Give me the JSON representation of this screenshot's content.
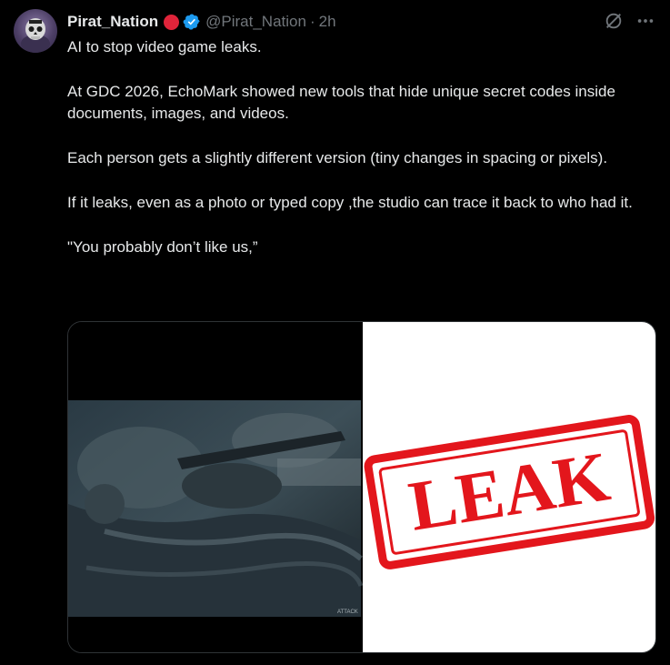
{
  "author": {
    "display_name": "Pirat_Nation",
    "handle": "@Pirat_Nation",
    "separator": "·",
    "timestamp": "2h"
  },
  "icons": {
    "avatar": "avatar-skull-image",
    "badge": "red-circle-badge",
    "verified": "verified-check-icon",
    "grok": "grok-icon",
    "more": "more-options-icon"
  },
  "tweet": {
    "paragraphs": [
      "AI to stop video game leaks.",
      "At GDC 2026, EchoMark showed new tools that hide unique secret codes inside documents, images, and videos.",
      "Each person gets a slightly different version (tiny changes in spacing or pixels).",
      "If it leaks, even as a photo or typed copy ,the studio can trace it back to who had it.",
      "\"You probably don’t like us,”"
    ]
  },
  "media": {
    "left_image": {
      "caption": "ATTACK"
    },
    "right_image": {
      "stamp_text": "LEAK"
    }
  },
  "colors": {
    "background": "#000000",
    "text": "#e7e9ea",
    "muted": "#71767b",
    "verified_blue": "#1d9bf0",
    "badge_red": "#e0243a",
    "stamp_red": "#e3161c"
  }
}
